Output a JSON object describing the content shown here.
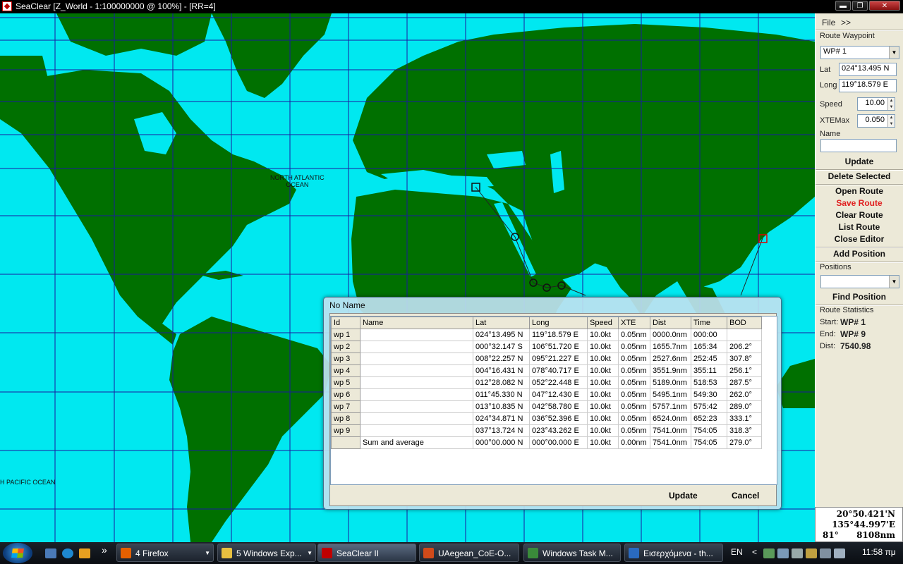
{
  "window": {
    "title": "SeaClear [Z_World - 1:100000000 @ 100%] - [RR=4]",
    "minimize": "▬",
    "restore": "❐",
    "close": "✕"
  },
  "map": {
    "labels": {
      "north_atlantic_1": "NORTH ATLANTIC",
      "north_atlantic_2": "OCEAN",
      "pacific": "H PACIFIC OCEAN"
    },
    "colors": {
      "sea": "#00e8f0",
      "land": "#007000",
      "grid": "#1a1aa0",
      "route": "#222222",
      "selected": "#e00000"
    }
  },
  "panel": {
    "menu_file": "File",
    "menu_more": ">>",
    "route_waypoint_label": "Route Waypoint",
    "waypoint_select": "WP# 1",
    "lat_label": "Lat",
    "lat_value": "024°13.495 N",
    "long_label": "Long",
    "long_value": "119°18.579 E",
    "speed_label": "Speed",
    "speed_value": "10.00",
    "xtemax_label": "XTEMax",
    "xtemax_value": "0.050",
    "name_label": "Name",
    "name_value": "",
    "update": "Update",
    "delete_selected": "Delete Selected",
    "open_route": "Open Route",
    "save_route": "Save Route",
    "clear_route": "Clear Route",
    "list_route": "List Route",
    "close_editor": "Close Editor",
    "add_position": "Add Position",
    "positions_label": "Positions",
    "positions_value": "",
    "find_position": "Find Position",
    "route_statistics": "Route Statistics",
    "start_label": "Start:",
    "start_value": "WP# 1",
    "end_label": "End:",
    "end_value": "WP# 9",
    "dist_label": "Dist:",
    "dist_value": "7540.98",
    "cursor_lat": "20°50.421'N",
    "cursor_long": "135°44.997'E",
    "cursor_bearing": "81°",
    "cursor_dist": "8108nm"
  },
  "dialog": {
    "title": "No Name",
    "columns": [
      "Id",
      "Name",
      "Lat",
      "Long",
      "Speed",
      "XTE",
      "Dist",
      "Time",
      "BOD"
    ],
    "rows": [
      [
        "wp 1",
        "",
        "024°13.495 N",
        "119°18.579 E",
        "10.0kt",
        "0.05nm",
        "0000.0nm",
        "000:00",
        ""
      ],
      [
        "wp 2",
        "",
        "000°32.147 S",
        "106°51.720 E",
        "10.0kt",
        "0.05nm",
        "1655.7nm",
        "165:34",
        "206.2°"
      ],
      [
        "wp 3",
        "",
        "008°22.257 N",
        "095°21.227 E",
        "10.0kt",
        "0.05nm",
        "2527.6nm",
        "252:45",
        "307.8°"
      ],
      [
        "wp 4",
        "",
        "004°16.431 N",
        "078°40.717 E",
        "10.0kt",
        "0.05nm",
        "3551.9nm",
        "355:11",
        "256.1°"
      ],
      [
        "wp 5",
        "",
        "012°28.082 N",
        "052°22.448 E",
        "10.0kt",
        "0.05nm",
        "5189.0nm",
        "518:53",
        "287.5°"
      ],
      [
        "wp 6",
        "",
        "011°45.330 N",
        "047°12.430 E",
        "10.0kt",
        "0.05nm",
        "5495.1nm",
        "549:30",
        "262.0°"
      ],
      [
        "wp 7",
        "",
        "013°10.835 N",
        "042°58.780 E",
        "10.0kt",
        "0.05nm",
        "5757.1nm",
        "575:42",
        "289.0°"
      ],
      [
        "wp 8",
        "",
        "024°34.871 N",
        "036°52.396 E",
        "10.0kt",
        "0.05nm",
        "6524.0nm",
        "652:23",
        "333.1°"
      ],
      [
        "wp 9",
        "",
        "037°13.724 N",
        "023°43.262 E",
        "10.0kt",
        "0.05nm",
        "7541.0nm",
        "754:05",
        "318.3°"
      ],
      [
        "",
        "Sum and average",
        "000°00.000 N",
        "000°00.000 E",
        "10.0kt",
        "0.00nm",
        "7541.0nm",
        "754:05",
        "279.0°"
      ]
    ],
    "update": "Update",
    "cancel": "Cancel"
  },
  "taskbar": {
    "items": [
      {
        "label": "4 Firefox",
        "icon": "firefox-icon",
        "color": "#e66000"
      },
      {
        "label": "5 Windows Exp...",
        "icon": "folder-icon",
        "color": "#e8c040"
      },
      {
        "label": "SeaClear II",
        "icon": "seaclear-icon",
        "color": "#c00000"
      },
      {
        "label": "UAegean_CoE-O...",
        "icon": "powerpoint-icon",
        "color": "#d04a1a"
      },
      {
        "label": "Windows Task M...",
        "icon": "task-manager-icon",
        "color": "#3a8a3a"
      },
      {
        "label": "Εισερχόμενα - th...",
        "icon": "mail-icon",
        "color": "#2a6ac0"
      }
    ],
    "more": "»",
    "lang": "EN",
    "tray_arrow": "<",
    "time": "11:58 πμ"
  }
}
